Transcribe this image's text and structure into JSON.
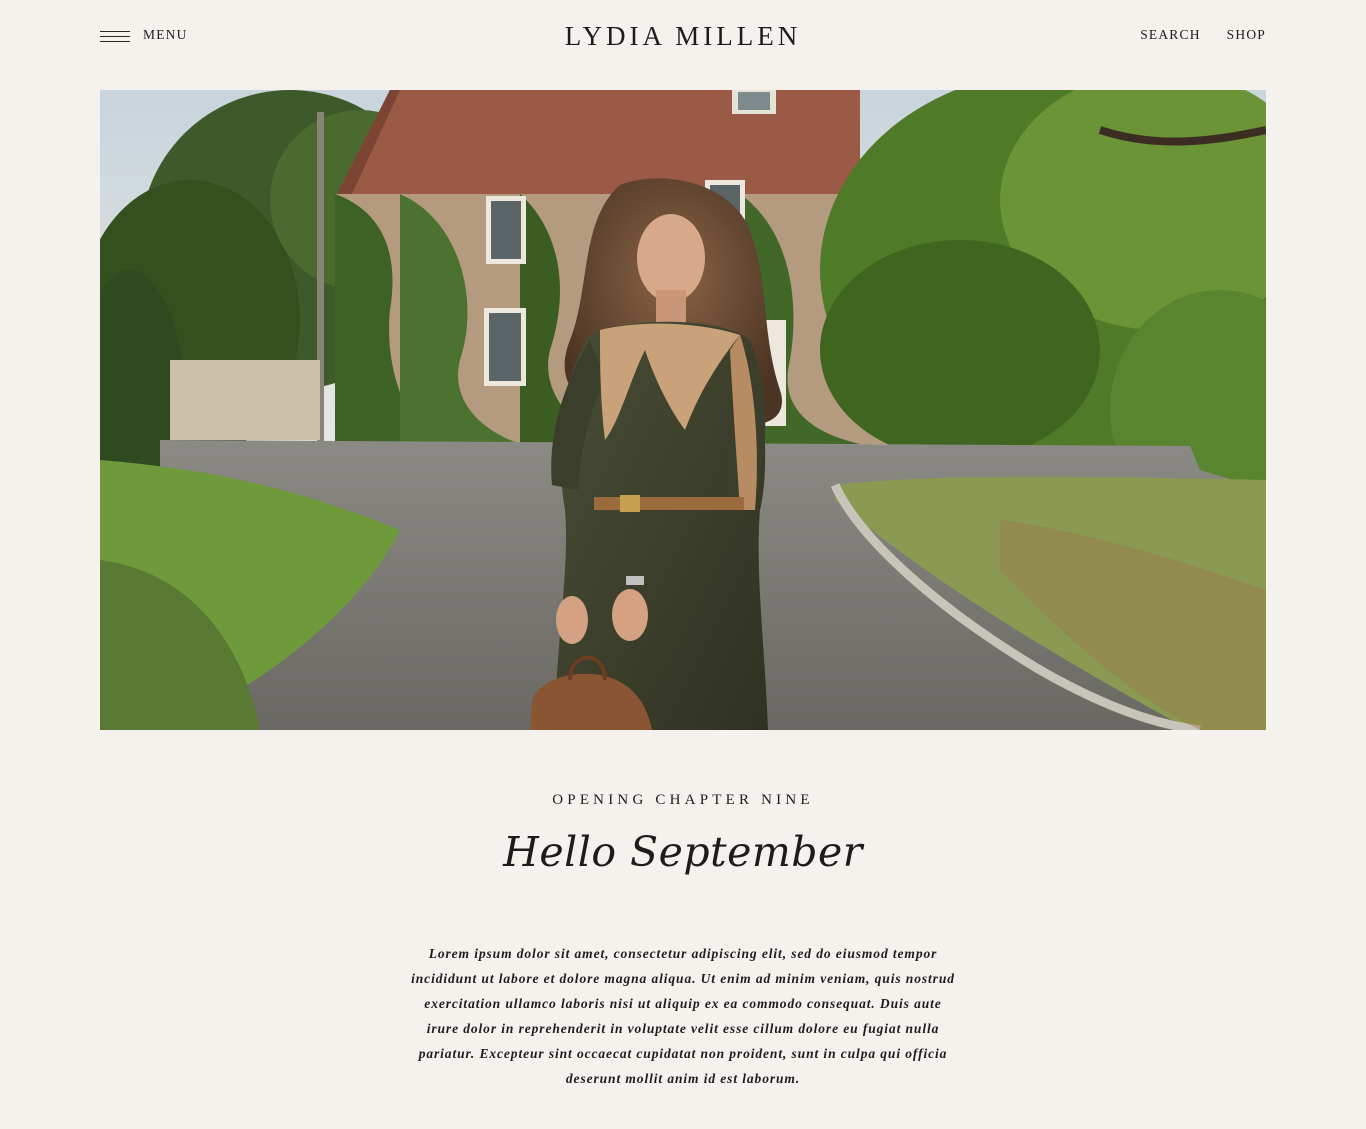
{
  "header": {
    "menu_label": "MENU",
    "logo": "LYDIA MILLEN",
    "links": [
      {
        "label": "SEARCH"
      },
      {
        "label": "SHOP"
      }
    ]
  },
  "article": {
    "kicker": "OPENING CHAPTER NINE",
    "title": "Hello September",
    "body": "Lorem ipsum dolor sit amet, consectetur adipiscing elit, sed do eiusmod tempor incididunt ut labore et dolore magna aliqua. Ut enim ad minim veniam, quis nostrud exercitation ullamco laboris nisi ut aliquip ex ea commodo consequat. Duis aute irure dolor in reprehenderit in voluptate velit esse cillum dolore eu fugiat nulla pariatur. Excepteur sint occaecat cupidatat non proident, sunt in culpa qui officia deserunt mollit anim id est laborum."
  },
  "colors": {
    "background": "#f5f2ee",
    "text": "#1e1c1a"
  },
  "icons": {
    "menu": "hamburger-icon"
  }
}
